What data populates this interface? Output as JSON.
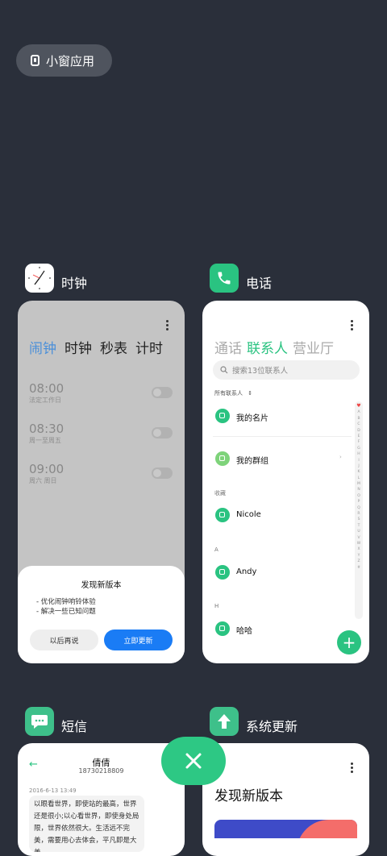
{
  "floating_window": {
    "label": "小窗应用"
  },
  "clock_app": {
    "name": "时钟",
    "tabs": [
      "闹钟",
      "时钟",
      "秒表",
      "计时"
    ],
    "alarms": [
      {
        "time": "08:00",
        "sub": "法定工作日"
      },
      {
        "time": "08:30",
        "sub": "周一至周五"
      },
      {
        "time": "09:00",
        "sub": "周六 周日"
      }
    ],
    "dialog": {
      "title": "发现新版本",
      "items": [
        "- 优化闹钟响铃体验",
        "- 解决一些已知问题"
      ],
      "later": "以后再说",
      "update": "立即更新"
    }
  },
  "phone_app": {
    "name": "电话",
    "tabs": [
      "通话",
      "联系人",
      "营业厅"
    ],
    "search_placeholder": "搜索13位联系人",
    "filter": "所有联系人",
    "contacts": {
      "my_card": "我的名片",
      "my_group": "我的群组",
      "favorites_label": "收藏",
      "favorite": "Nicole",
      "a_label": "A",
      "a_contact": "Andy",
      "h_label": "H",
      "h_contact": "哈哈"
    },
    "alphabet": [
      "A",
      "B",
      "C",
      "D",
      "E",
      "F",
      "G",
      "H",
      "I",
      "J",
      "K",
      "L",
      "M",
      "N",
      "O",
      "P",
      "Q",
      "R",
      "S",
      "T",
      "U",
      "V",
      "W",
      "X",
      "Y",
      "Z",
      "#"
    ],
    "fab": "+"
  },
  "sms_app": {
    "name": "短信",
    "contact_name": "倩倩",
    "contact_number": "18730218809",
    "date": "2016-6-13 13:49",
    "message": "以眼看世界，即使站的最高，世界还是很小;以心看世界，即使身处局限，世界依然很大。生活远不完美，需要用心去体会，平凡即是大美"
  },
  "update_app": {
    "name": "系统更新",
    "title": "发现新版本"
  },
  "colors": {
    "accent_green": "#2ac381",
    "accent_blue": "#1a7cf5",
    "background": "#2a2f3a"
  }
}
